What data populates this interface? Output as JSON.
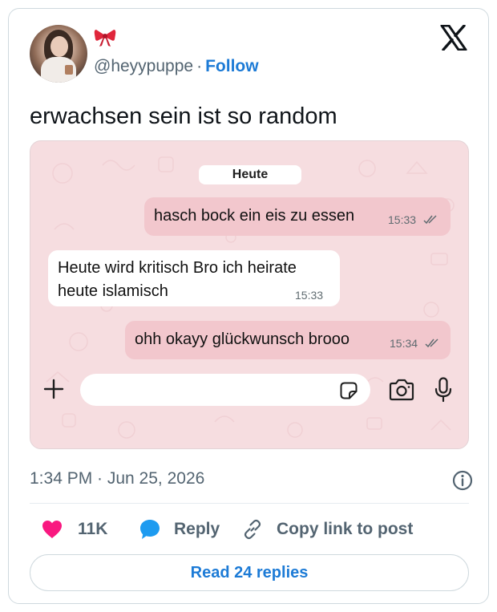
{
  "tweet": {
    "handle": "@heyypuppe",
    "separator": "·",
    "follow_label": "Follow",
    "text": "erwachsen sein ist so random",
    "timestamp": "1:34 PM · Jun 25, 2026",
    "likes_count": "11K",
    "reply_label": "Reply",
    "copy_link_label": "Copy link to post",
    "read_replies_label": "Read 24 replies",
    "icons": {
      "logo": "x-logo-icon",
      "bow": "ribbon-bow-icon",
      "info": "info-icon",
      "like": "heart-icon",
      "reply": "speech-bubble-icon",
      "copy": "link-icon"
    },
    "colors": {
      "accent": "#1d7bd6",
      "like": "#f91880",
      "muted": "#536471"
    }
  },
  "chat": {
    "date_label": "Heute",
    "messages": [
      {
        "direction": "outgoing",
        "text": "hasch bock ein eis zu essen",
        "time": "15:33",
        "read": true
      },
      {
        "direction": "incoming",
        "text": "Heute wird kritisch Bro ich heirate heute islamisch",
        "time": "15:33",
        "read": false
      },
      {
        "direction": "outgoing",
        "text": "ohh okayy glückwunsch brooo",
        "time": "15:34",
        "read": true
      }
    ],
    "input_placeholder": "",
    "icons": [
      "plus-icon",
      "sticker-icon",
      "camera-icon",
      "microphone-icon"
    ],
    "colors": {
      "background": "#f6dde0",
      "outgoing_bubble": "#f2c7cd",
      "incoming_bubble": "#ffffff"
    }
  }
}
